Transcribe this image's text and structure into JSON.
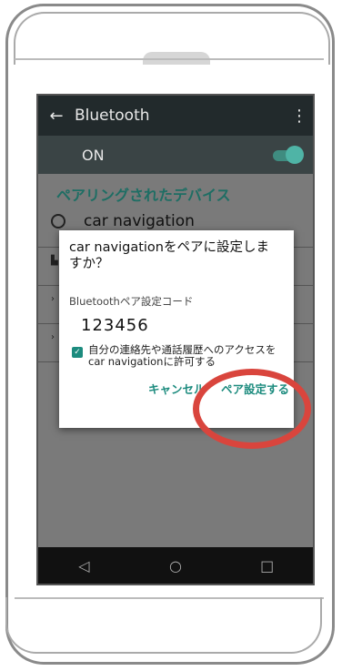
{
  "appbar": {
    "title": "Bluetooth"
  },
  "bluetooth": {
    "state_label": "ON"
  },
  "section": {
    "header": "ペアリングされたデバイス"
  },
  "device": {
    "name": "car navigation"
  },
  "dialog": {
    "title": "car navigationをペアに設定しますか？",
    "code_label": "Bluetoothペア設定コード",
    "code": "123456",
    "checkbox_label": "自分の連絡先や通話履歴へのアクセスをcar navigationに許可する",
    "checkbox_checked": true,
    "cancel_label": "キャンセル",
    "pair_label": "ペア設定する"
  },
  "colors": {
    "accent": "#1c8b7e",
    "highlight": "#d9453d"
  }
}
